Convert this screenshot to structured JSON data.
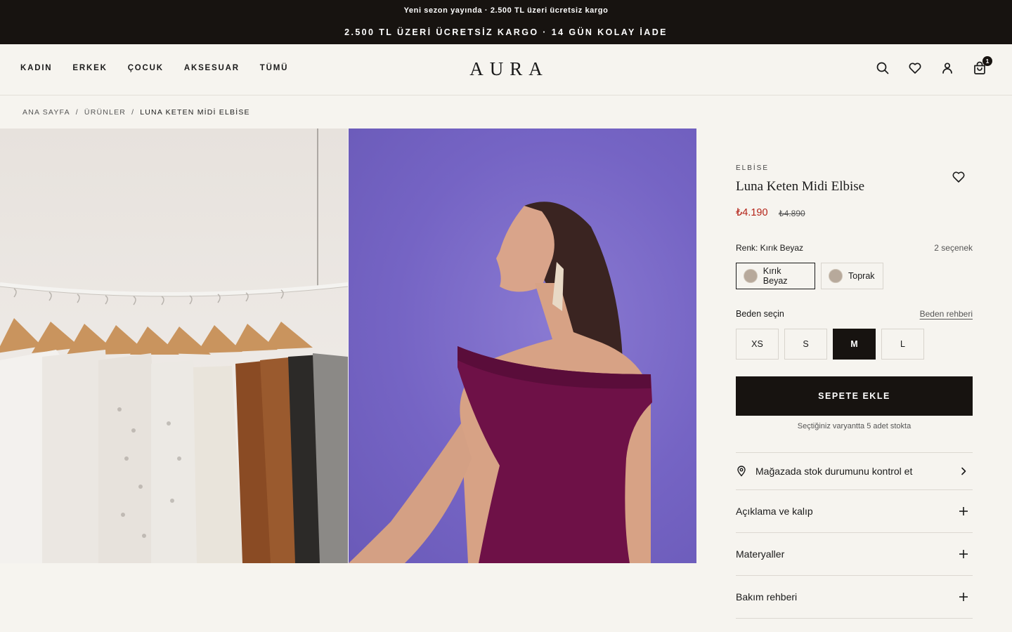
{
  "announcement": {
    "line1": "Yeni sezon yayında · 2.500 TL üzeri ücretsiz kargo",
    "line2": "2.500 TL ÜZERİ ÜCRETSİZ KARGO · 14 GÜN KOLAY İADE"
  },
  "header": {
    "logo": "AURA",
    "nav": [
      "KADIN",
      "ERKEK",
      "ÇOCUK",
      "AKSESUAR",
      "TÜMÜ"
    ],
    "icons": [
      "search-icon",
      "heart-icon",
      "user-icon",
      "bag-icon"
    ],
    "cart_count": "1"
  },
  "breadcrumb": {
    "items": [
      "ANA SAYFA",
      "ÜRÜNLER",
      "LUNA KETEN MİDİ ELBİSE"
    ],
    "separator": "/"
  },
  "product": {
    "category": "ELBİSE",
    "title": "Luna Keten Midi Elbise",
    "price": "₺4.190",
    "old_price": "₺4.890",
    "color_label": "Renk: Kırık Beyaz",
    "color_count": "2 seçenek",
    "colors": [
      {
        "name": "Kırık Beyaz",
        "selected": true
      },
      {
        "name": "Toprak",
        "selected": false
      }
    ],
    "size_label": "Beden seçin",
    "size_guide": "Beden rehberi",
    "sizes": [
      {
        "label": "XS",
        "selected": false
      },
      {
        "label": "S",
        "selected": false
      },
      {
        "label": "M",
        "selected": true
      },
      {
        "label": "L",
        "selected": false
      }
    ],
    "add_to_cart": "SEPETE EKLE",
    "stock_note": "Seçtiğiniz varyantta 5 adet stokta",
    "store_check": "Mağazada stok durumunu kontrol et",
    "accordions": [
      "Açıklama ve kalıp",
      "Materyaller",
      "Bakım rehberi"
    ]
  },
  "colors": {
    "announcement_bg": "#171310",
    "page_bg": "#f6f4ef",
    "sale_price": "#b42318",
    "button_bg": "#171310"
  }
}
